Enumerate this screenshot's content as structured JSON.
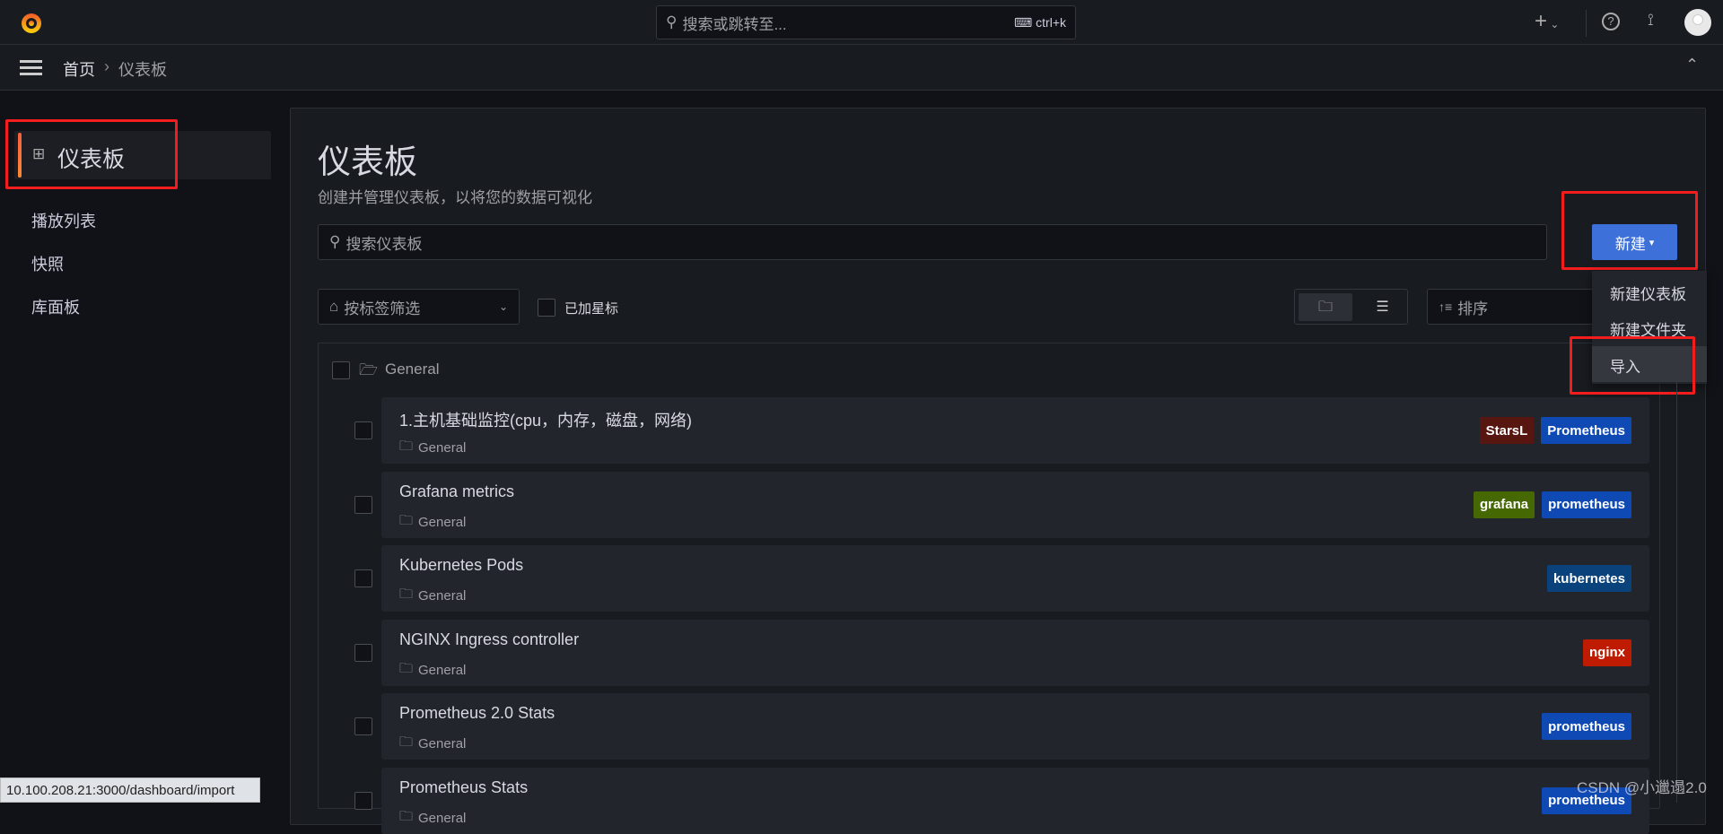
{
  "topbar": {
    "search_placeholder": "搜索或跳转至...",
    "shortcut": "ctrl+k"
  },
  "breadcrumb": {
    "home": "首页",
    "separator": "›",
    "current": "仪表板"
  },
  "sidebar": {
    "active": "仪表板",
    "items": [
      {
        "label": "播放列表"
      },
      {
        "label": "快照"
      },
      {
        "label": "库面板"
      }
    ]
  },
  "main": {
    "title": "仪表板",
    "subtitle": "创建并管理仪表板，以将您的数据可视化",
    "search_placeholder": "搜索仪表板",
    "new_button": "新建",
    "new_menu": [
      "新建仪表板",
      "新建文件夹",
      "导入"
    ],
    "tag_filter_placeholder": "按标签筛选",
    "starred_label": "已加星标",
    "sort_placeholder": "排序",
    "folder": "General",
    "dashboards": [
      {
        "title": "1.主机基础监控(cpu，内存，磁盘，网络)",
        "folder": "General",
        "tags": [
          {
            "label": "StarsL",
            "color": "#581610"
          },
          {
            "label": "Prometheus",
            "color": "#0f4ab4"
          }
        ]
      },
      {
        "title": "Grafana metrics",
        "folder": "General",
        "tags": [
          {
            "label": "grafana",
            "color": "#466803"
          },
          {
            "label": "prometheus",
            "color": "#0f4ab4"
          }
        ]
      },
      {
        "title": "Kubernetes Pods",
        "folder": "General",
        "tags": [
          {
            "label": "kubernetes",
            "color": "#0a437c"
          }
        ]
      },
      {
        "title": "NGINX Ingress controller",
        "folder": "General",
        "tags": [
          {
            "label": "nginx",
            "color": "#bf1b00"
          }
        ]
      },
      {
        "title": "Prometheus 2.0 Stats",
        "folder": "General",
        "tags": [
          {
            "label": "prometheus",
            "color": "#0f4ab4"
          }
        ]
      },
      {
        "title": "Prometheus Stats",
        "folder": "General",
        "tags": [
          {
            "label": "prometheus",
            "color": "#0f4ab4"
          }
        ]
      }
    ]
  },
  "status_url": "10.100.208.21:3000/dashboard/import",
  "watermark": "CSDN @小邋遢2.0",
  "colors": {
    "primary": "#3d71d9",
    "annotation": "#f41d1d"
  }
}
